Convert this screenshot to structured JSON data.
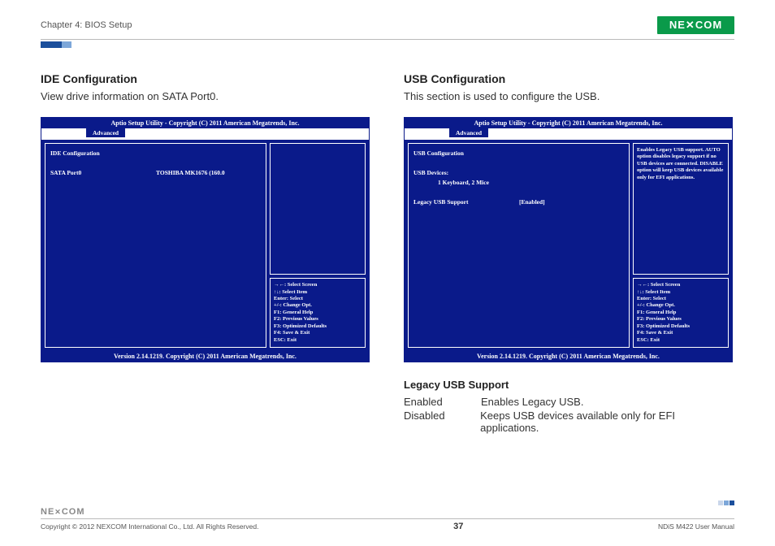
{
  "header": {
    "chapter": "Chapter 4: BIOS Setup",
    "logo_text": "NE COM"
  },
  "left": {
    "title": "IDE Configuration",
    "desc": "View drive information on SATA Port0.",
    "bios": {
      "top": "Aptio Setup Utility - Copyright (C) 2011 American Megatrends, Inc.",
      "tab": "Advanced",
      "heading": "IDE Configuration",
      "row_label": "SATA Port0",
      "row_value": "TOSHIBA MK1676 (160.0",
      "footer": "Version 2.14.1219. Copyright (C) 2011 American Megatrends, Inc."
    }
  },
  "right": {
    "title": "USB Configuration",
    "desc": "This section is used to configure the USB.",
    "bios": {
      "top": "Aptio Setup Utility - Copyright (C) 2011 American Megatrends, Inc.",
      "tab": "Advanced",
      "heading": "USB Configuration",
      "devices_label": "USB Devices:",
      "devices_value": "1 Keyboard, 2 Mice",
      "setting_label": "Legacy USB Support",
      "setting_value": "[Enabled]",
      "help_text": "Enables Legacy USB support. AUTO option disables legacy support if no USB devices are connected. DISABLE option will keep USB devices available only for EFI applications.",
      "footer": "Version 2.14.1219. Copyright (C) 2011 American Megatrends, Inc."
    },
    "sub_title": "Legacy USB Support",
    "defs": [
      {
        "term": "Enabled",
        "desc": "Enables Legacy USB."
      },
      {
        "term": "Disabled",
        "desc": "Keeps USB devices available only for EFI applications."
      }
    ]
  },
  "keyhelp": {
    "l1": "→←: Select Screen",
    "l2": "↑↓: Select Item",
    "l3": "Enter: Select",
    "l4": "+/-: Change Opt.",
    "l5": "F1: General Help",
    "l6": "F2: Previous Values",
    "l7": "F3: Optimized Defaults",
    "l8": "F4: Save & Exit",
    "l9": "ESC: Exit"
  },
  "footer": {
    "logo": "NE COM",
    "copyright": "Copyright © 2012 NEXCOM International Co., Ltd. All Rights Reserved.",
    "page": "37",
    "manual": "NDiS M422 User Manual"
  }
}
